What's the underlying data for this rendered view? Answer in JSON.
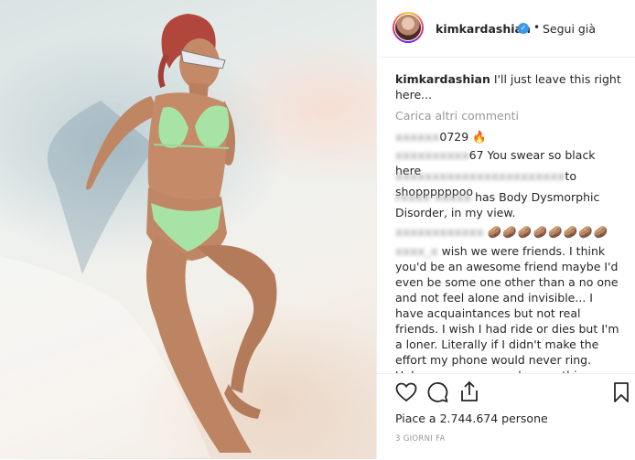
{
  "post": {
    "username": "kimkardashian",
    "verified_icon": "verified-badge-icon",
    "separator": "•",
    "follow_status": "Segui già",
    "caption_user": "kimkardashian",
    "caption_text": "I'll just leave this right here...",
    "load_more": "Carica altri commenti",
    "comments": [
      {
        "user": "xxxxxx",
        "text": "0729 🔥"
      },
      {
        "user": "xxxxxxxxxx",
        "text": "67 You swear so black here"
      },
      {
        "user": "xxxxxxxxxxxxxxxxxxxxxxx",
        "text": "to shoppppppoo"
      },
      {
        "user": "rxxxx xxxxx",
        "text": "has Body Dysmorphic Disorder, in my view."
      },
      {
        "user": "xxxxxxxxxxxx",
        "text": "🥔🥔🥔🥔🥔🥔🥔🥔"
      },
      {
        "user": "xxxx_x",
        "text": "wish we were friends. I think you'd be an awesome friend maybe I'd even be some one other than a no one and not feel alone and invisible... I have acquaintances but not real friends. I wish I had ride or dies but I'm a loner. Literally if I didn't make the effort my phone would never ring. Unless someone needs something because I'm always helpful. Idk why I'm venting on your"
      }
    ],
    "likes": "Piace a 2.744.674 persone",
    "time_ago": "3 GIORNI FA",
    "icons": {
      "like": "heart-icon",
      "comment": "comment-icon",
      "share": "share-icon",
      "save": "bookmark-icon"
    },
    "colors": {
      "verified": "#3897f0",
      "text": "#262626",
      "muted": "#999999",
      "swimsuit": "#a8e3a6"
    }
  }
}
